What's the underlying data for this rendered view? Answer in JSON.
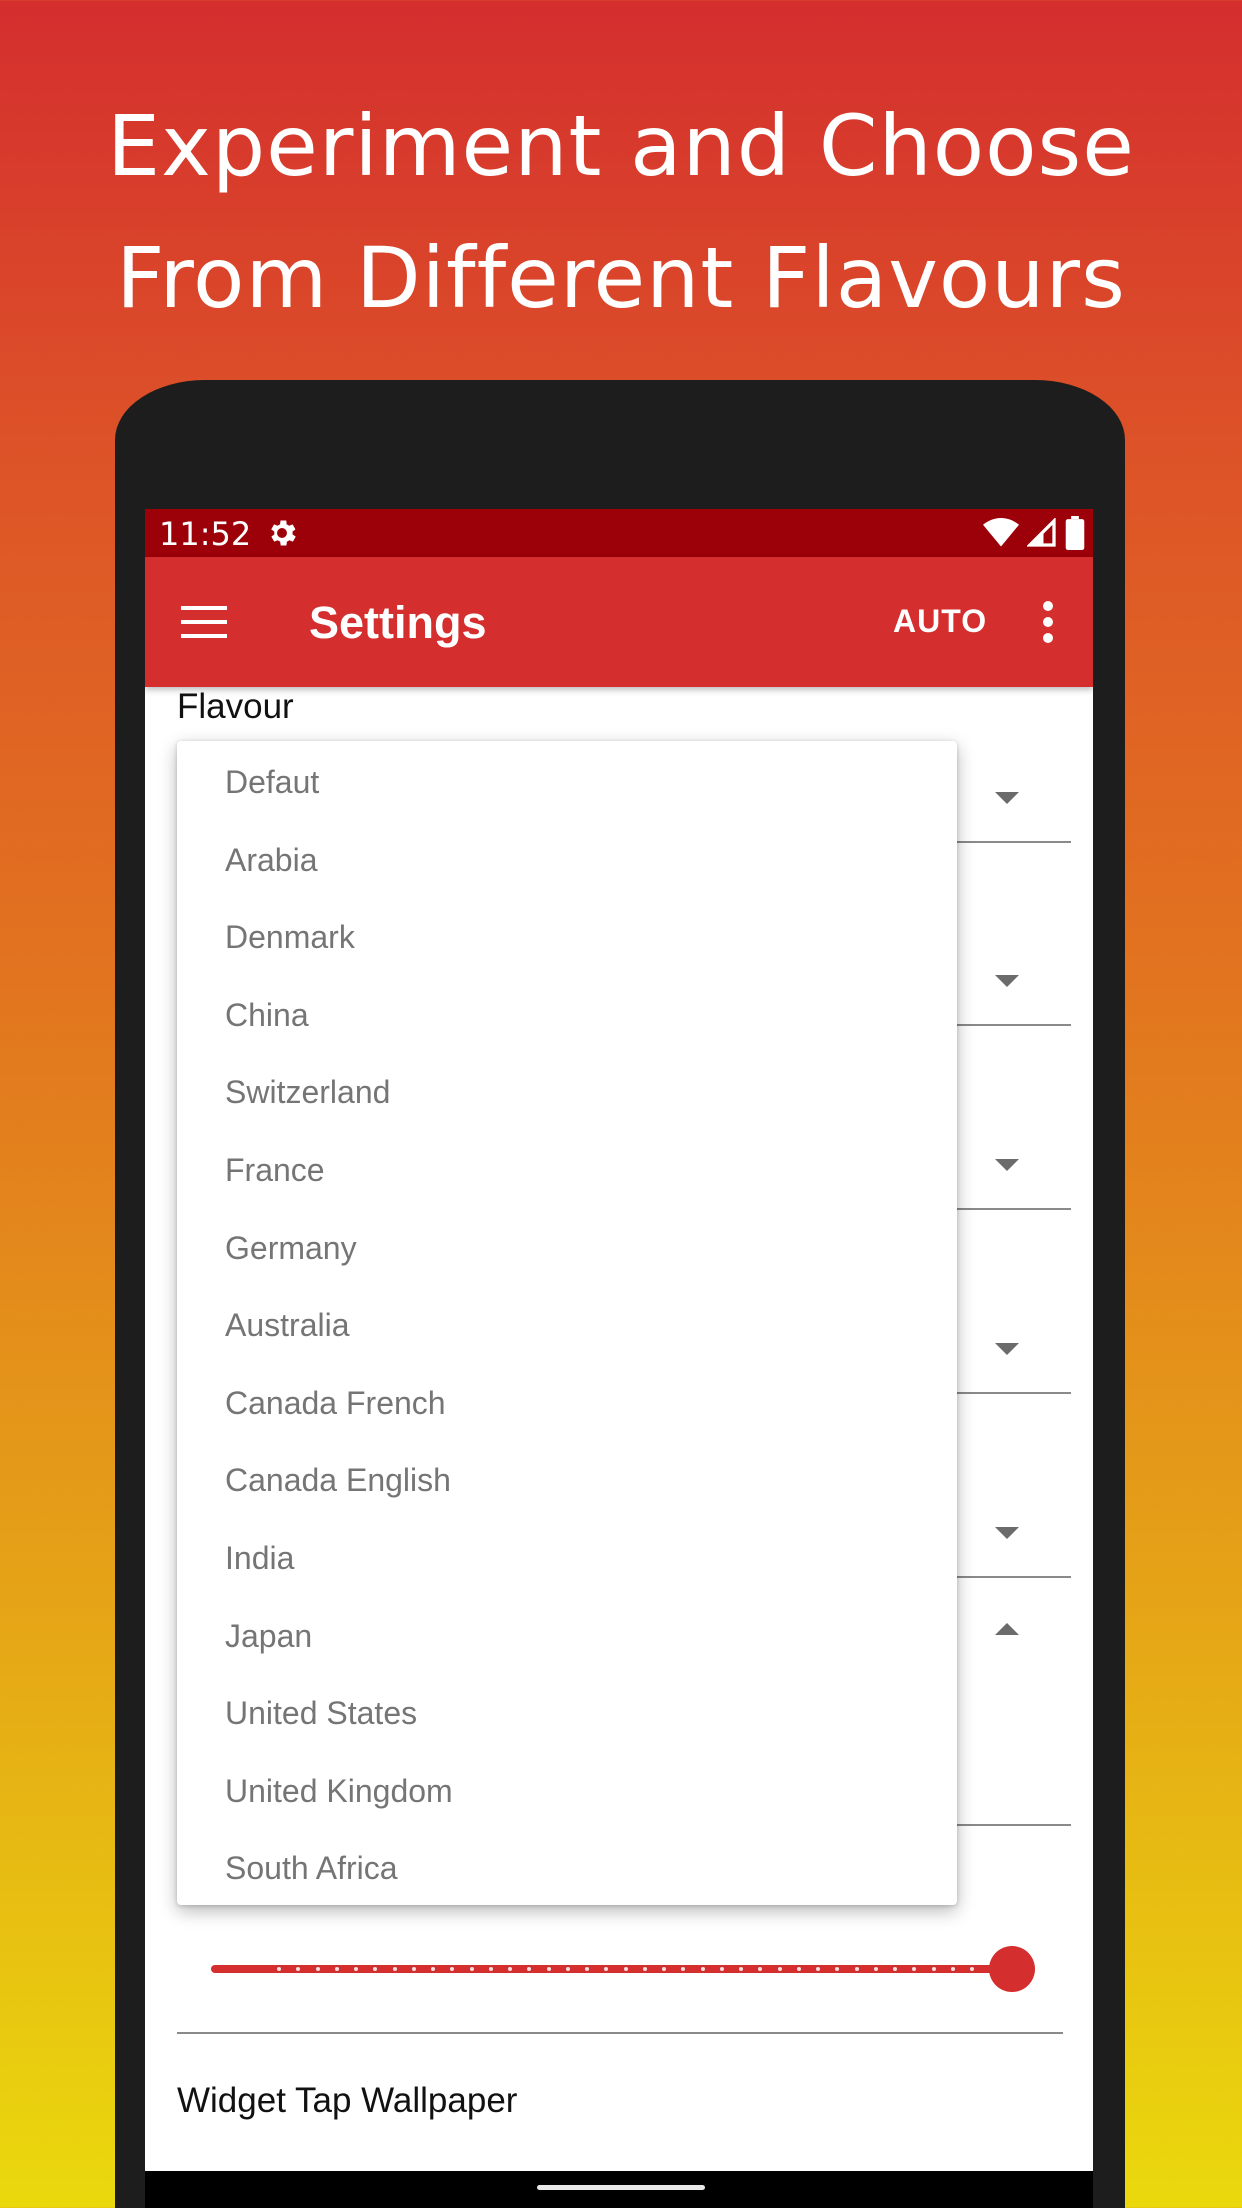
{
  "headline": {
    "line1": "Experiment and Choose",
    "line2": "From Different Flavours"
  },
  "statusbar": {
    "time": "11:52",
    "icons": [
      "gear-icon",
      "wifi-icon",
      "signal-icon",
      "battery-icon"
    ]
  },
  "appbar": {
    "title": "Settings",
    "auto_label": "AUTO",
    "icons": [
      "menu-icon",
      "overflow-menu-icon"
    ]
  },
  "settings": {
    "flavour_label": "Flavour",
    "widget_tap_label": "Widget Tap Wallpaper"
  },
  "dropdown": {
    "options": [
      "Defaut",
      "Arabia",
      "Denmark",
      "China",
      "Switzerland",
      "France",
      "Germany",
      "Australia",
      "Canada French",
      "Canada English",
      "India",
      "Japan",
      "United States",
      "United Kingdom",
      "South Africa"
    ]
  },
  "slider": {
    "value_fraction": 1.0
  },
  "colors": {
    "primary": "#d42e2e",
    "status_bar": "#9c0009",
    "gradient_top": "#d42e2e",
    "gradient_bottom": "#ead90d",
    "phone_frame": "#1d1d1d"
  }
}
